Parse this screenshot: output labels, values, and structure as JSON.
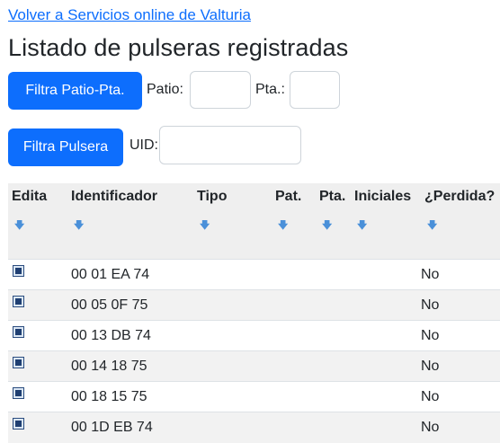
{
  "nav": {
    "back_link": "Volver a Servicios online de Valturia"
  },
  "page_title": "Listado de pulseras registradas",
  "filter_patio": {
    "button": "Filtra Patio-Pta.",
    "patio_label": "Patio:",
    "patio_value": "",
    "pta_label": "Pta.:",
    "pta_value": ""
  },
  "filter_uid": {
    "button": "Filtra Pulsera",
    "uid_label": "UID:",
    "uid_value": ""
  },
  "table": {
    "headers": [
      "Edita",
      "Identificador",
      "Tipo",
      "Pat.",
      "Pta.",
      "Iniciales",
      "¿Perdida?"
    ],
    "sort_icon": "sort-down-arrow-icon",
    "rows": [
      {
        "id": "00 01 EA 74",
        "tipo": "",
        "pat": "",
        "pta": "",
        "iniciales": "",
        "perdida": "No"
      },
      {
        "id": "00 05 0F 75",
        "tipo": "",
        "pat": "",
        "pta": "",
        "iniciales": "",
        "perdida": "No"
      },
      {
        "id": "00 13 DB 74",
        "tipo": "",
        "pat": "",
        "pta": "",
        "iniciales": "",
        "perdida": "No"
      },
      {
        "id": "00 14 18 75",
        "tipo": "",
        "pat": "",
        "pta": "",
        "iniciales": "",
        "perdida": "No"
      },
      {
        "id": "00 18 15 75",
        "tipo": "",
        "pat": "",
        "pta": "",
        "iniciales": "",
        "perdida": "No"
      },
      {
        "id": "00 1D EB 74",
        "tipo": "",
        "pat": "",
        "pta": "",
        "iniciales": "",
        "perdida": "No"
      }
    ]
  },
  "colors": {
    "primary": "#0d6efd",
    "header_bg": "#efefef",
    "stripe_bg": "#f2f2f2",
    "sort_arrow": "#4a90d9"
  }
}
